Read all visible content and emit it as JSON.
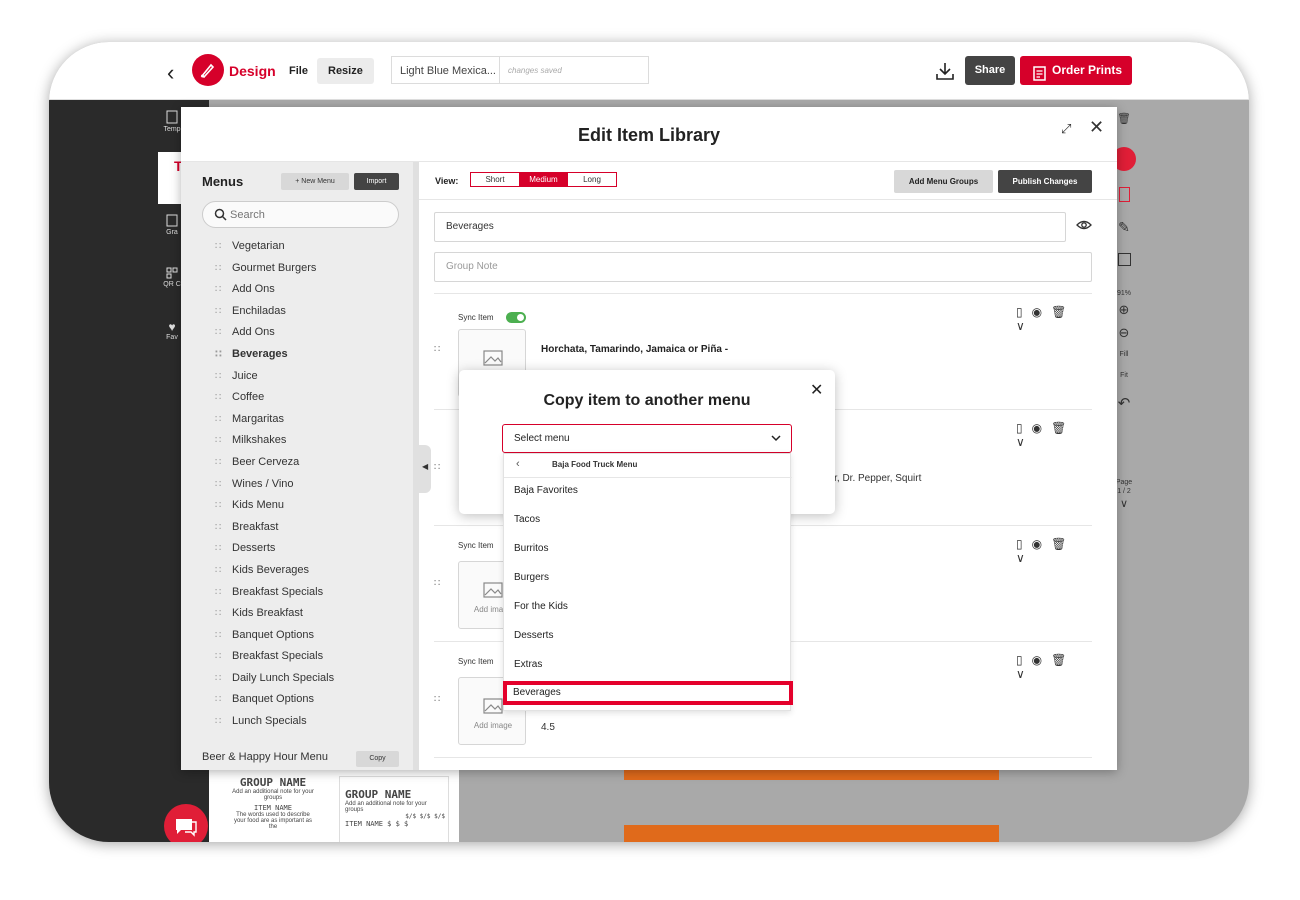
{
  "topbar": {
    "app_name": "Design",
    "file_label": "File",
    "resize_label": "Resize",
    "doc_title": "Light Blue Mexica...",
    "doc_status": "changes saved",
    "share_label": "Share",
    "order_label": "Order Prints"
  },
  "rail": {
    "items": [
      "Temp",
      "T",
      "Gra",
      "QR C",
      "Fav"
    ]
  },
  "right_tools": {
    "zoom": "91%",
    "fill1": "Fill",
    "fill2": "Fit",
    "page_label": "Page",
    "page_num": "1 / 2"
  },
  "library": {
    "title": "Edit Item Library",
    "menus_title": "Menus",
    "new_menu": "+ New Menu",
    "import": "Import",
    "search_placeholder": "Search",
    "menu_items": [
      "Vegetarian",
      "Gourmet Burgers",
      "Add Ons",
      "Enchiladas",
      "Add Ons",
      "Beverages",
      "Juice",
      "Coffee",
      "Margaritas",
      "Milkshakes",
      "Beer Cerveza",
      "Wines / Vino",
      "Kids Menu",
      "Breakfast",
      "Desserts",
      "Kids Beverages",
      "Breakfast Specials",
      "Kids Breakfast",
      "Banquet Options",
      "Breakfast Specials",
      "Daily Lunch Specials",
      "Banquet Options",
      "Lunch Specials"
    ],
    "bold_item_index": 5,
    "beer_menu": "Beer & Happy Hour Menu",
    "copy": "Copy",
    "view_label": "View:",
    "views": [
      "Short",
      "Medium",
      "Long"
    ],
    "active_view": "Medium",
    "add_groups": "Add Menu Groups",
    "publish": "Publish Changes",
    "group_name": "Beverages",
    "group_note_placeholder": "Group Note",
    "sync_label": "Sync Item",
    "add_image": "Add image",
    "item1_name": "Horchata, Tamarindo, Jamaica or Piña -",
    "item2_desc": "eer, Dr. Pepper, Squirt",
    "item4_price": "4.5"
  },
  "canvas": {
    "group_name": "GROUP NAME",
    "group_note": "Add an additional note for your groups",
    "item_name": "ITEM NAME",
    "item_desc": "The words used to describe your food are as important as the",
    "group_name2": "GROUP NAME",
    "group_note2": "Add an additional note for your groups",
    "prices": "$/$ $/$ $/$",
    "item_name2": "ITEM NAME",
    "dollars": "$ $ $"
  },
  "copy_modal": {
    "title": "Copy item to another menu",
    "select_placeholder": "Select menu",
    "dropdown_header": "Baja Food Truck Menu",
    "options": [
      "Baja Favorites",
      "Tacos",
      "Burritos",
      "Burgers",
      "For the Kids",
      "Desserts",
      "Extras",
      "Beverages"
    ],
    "highlighted_option": "Beverages"
  },
  "colors": {
    "brand": "#d6002a",
    "publish": "#444444",
    "toggle_on": "#4caf50"
  }
}
